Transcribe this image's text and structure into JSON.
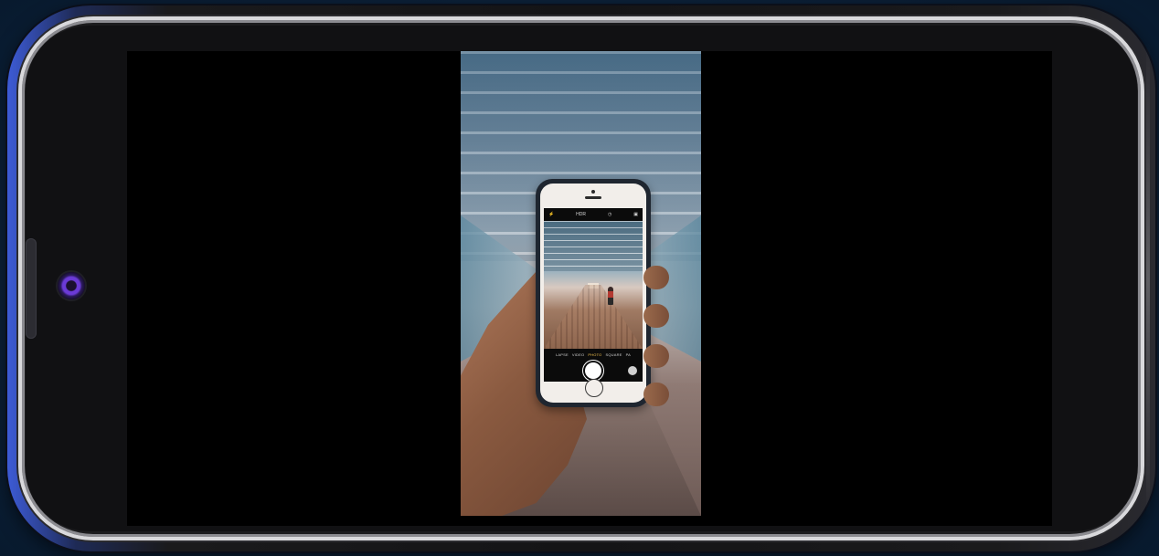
{
  "device": {
    "orientation": "landscape",
    "frame_accent_color": "#3d5bd6",
    "screen_background": "#000000"
  },
  "video": {
    "subject": "hand holding smartphone filming corridor",
    "held_phone": {
      "camera_top_bar": {
        "flash_icon": "flash-icon",
        "hdr_label": "HDR",
        "timer_icon": "timer-icon",
        "flip_icon": "camera-icon"
      },
      "camera_modes": [
        "LAPSE",
        "VIDEO",
        "PHOTO",
        "SQUARE",
        "PA"
      ],
      "active_mode": "PHOTO"
    }
  }
}
